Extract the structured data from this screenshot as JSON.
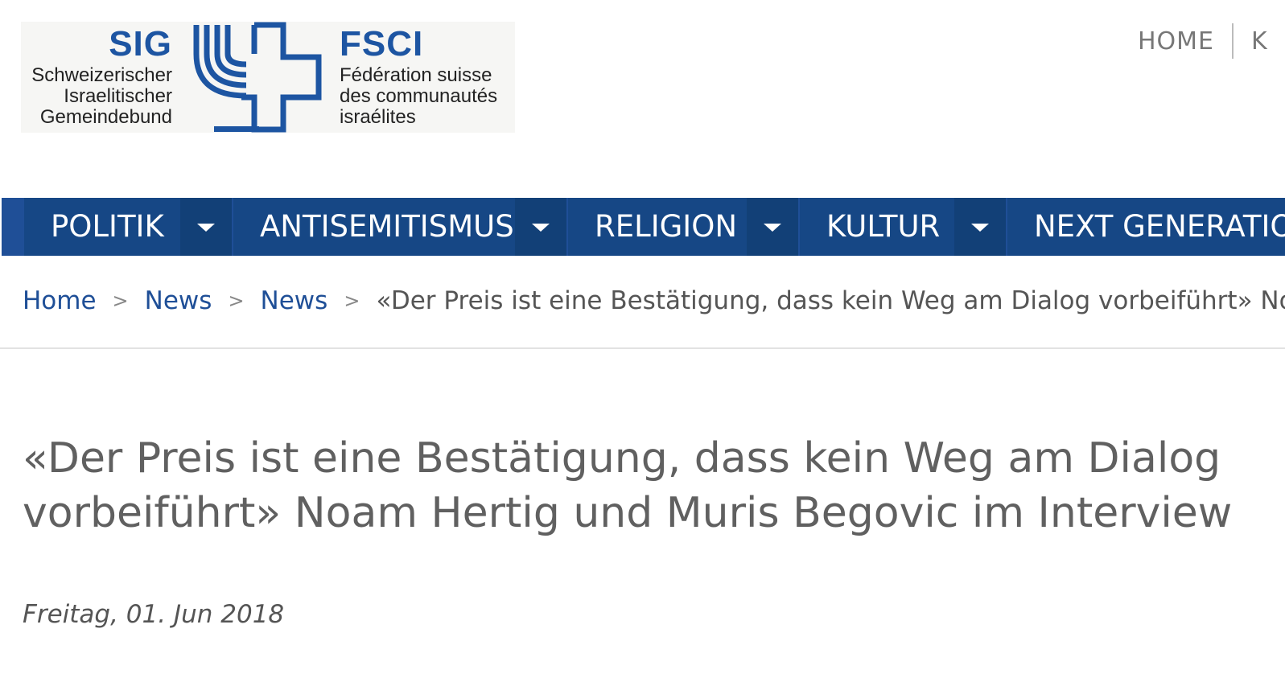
{
  "logo": {
    "sig": "SIG",
    "sig_lines": [
      "Schweizerischer",
      "Israelitischer",
      "Gemeindebund"
    ],
    "fsci": "FSCI",
    "fsci_lines": [
      "Fédération suisse",
      "des communautés",
      "israélites"
    ],
    "brand_color": "#1d55a2"
  },
  "topnav": {
    "home": "HOME",
    "next_partial": "K"
  },
  "mainnav": {
    "items": [
      {
        "label": "POLITIK",
        "icon": "chevron-down-icon"
      },
      {
        "label": "ANTISEMITISMUS",
        "icon": "chevron-down-icon"
      },
      {
        "label": "RELIGION",
        "icon": "chevron-down-icon"
      },
      {
        "label": "KULTUR",
        "icon": "chevron-down-icon"
      },
      {
        "label": "NEXT GENERATIO",
        "icon": "chevron-down-icon"
      }
    ],
    "bg_color": "#164785"
  },
  "breadcrumb": {
    "items": [
      "Home",
      "News",
      "News"
    ],
    "separator": ">",
    "current": "«Der Preis ist eine Bestätigung, dass kein Weg am Dialog vorbeiführt» Noam He"
  },
  "article": {
    "title": "«Der Preis ist eine Bestätigung, dass kein Weg am Dialog vorbeiführt» Noam Hertig und Muris Begovic im Interview",
    "date": "Freitag, 01. Jun 2018"
  }
}
